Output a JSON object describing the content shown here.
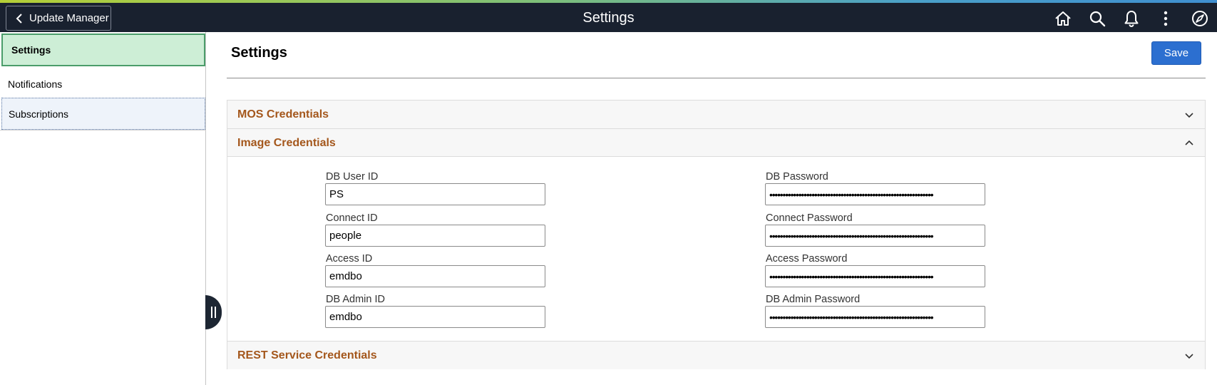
{
  "header": {
    "back_label": "Update Manager",
    "title": "Settings",
    "icons": [
      "home-icon",
      "search-icon",
      "bell-icon",
      "actions-menu-icon",
      "navbar-compass-icon"
    ]
  },
  "sidebar": {
    "items": [
      {
        "label": "Settings",
        "selected": true
      },
      {
        "label": "Notifications",
        "selected": false
      },
      {
        "label": "Subscriptions",
        "selected": false
      }
    ]
  },
  "page": {
    "title": "Settings",
    "save_label": "Save"
  },
  "sections": {
    "mos": {
      "title": "MOS Credentials",
      "expanded": false
    },
    "image": {
      "title": "Image Credentials",
      "expanded": true
    },
    "rest": {
      "title": "REST Service Credentials",
      "expanded": false
    }
  },
  "fields": {
    "db_user_id": {
      "label": "DB User ID",
      "value": "PS"
    },
    "connect_id": {
      "label": "Connect ID",
      "value": "people"
    },
    "access_id": {
      "label": "Access ID",
      "value": "emdbo"
    },
    "db_admin_id": {
      "label": "DB Admin ID",
      "value": "emdbo"
    },
    "db_password": {
      "label": "DB Password",
      "value": "••••••••••••••••••••••••••••••••••••••••••••••••••••••••••••••"
    },
    "connect_password": {
      "label": "Connect Password",
      "value": "••••••••••••••••••••••••••••••••••••••••••••••••••••••••••••••"
    },
    "access_password": {
      "label": "Access Password",
      "value": "••••••••••••••••••••••••••••••••••••••••••••••••••••••••••••••"
    },
    "db_admin_password": {
      "label": "DB Admin Password",
      "value": "••••••••••••••••••••••••••••••••••••••••••••••••••••••••••••••"
    }
  },
  "colors": {
    "header_bg": "#19212f",
    "section_title": "#a4571c",
    "primary_button": "#2c6fd0",
    "selected_nav_bg": "#cdeed6",
    "selected_nav_border": "#4b9d6a"
  }
}
